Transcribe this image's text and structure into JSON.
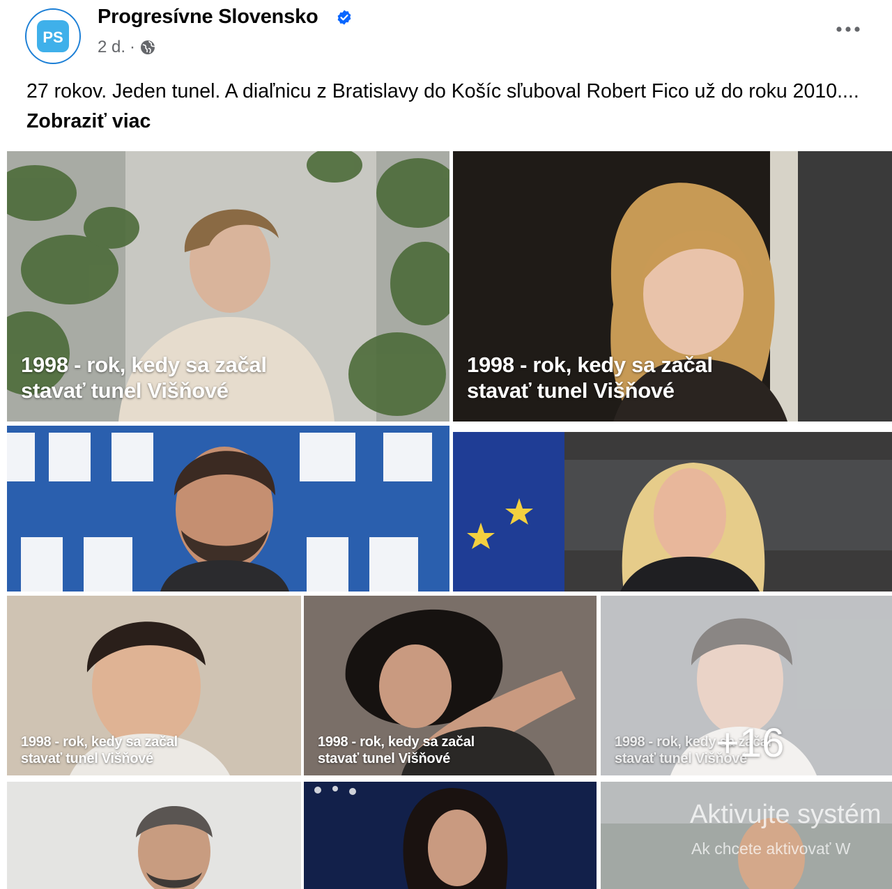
{
  "post": {
    "page_name": "Progresívne Slovensko",
    "avatar_text": "PS",
    "time": "2 d.",
    "separator": "·",
    "privacy_icon": "globe-icon",
    "more_icon": "more-horizontal-icon",
    "text_main": "27 rokov. Jeden tunel. A diaľnicu z Bratislavy do Košíc sľuboval Robert Fico už do roku 2010....",
    "see_more": "Zobraziť viac"
  },
  "photos": {
    "caption_line1": "1998 - rok, kedy sa začal",
    "caption_line2": "stavať tunel Višňové",
    "more_count": "+16"
  },
  "watermark": {
    "title": "Aktivujte systém",
    "subtitle": "Ak chcete aktivovať W"
  },
  "colors": {
    "brand_blue": "#1c7fd6",
    "verified_blue": "#0866ff",
    "meta_gray": "#65676b"
  }
}
